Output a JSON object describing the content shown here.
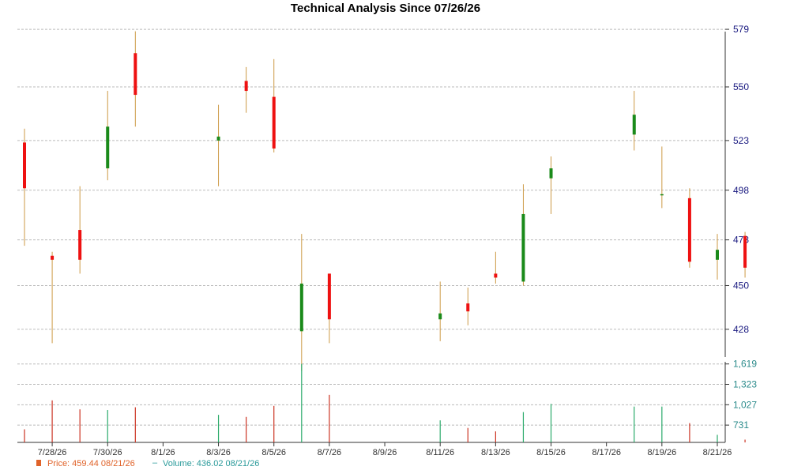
{
  "chart_data": {
    "type": "candlestick",
    "title": "Technical Analysis Since 07/26/26",
    "price_axis": {
      "ticks": [
        428,
        450,
        473,
        498,
        523,
        550,
        579
      ],
      "range": [
        414,
        585
      ]
    },
    "volume_axis": {
      "tick_labels": [
        "731",
        "1,027",
        "1,323",
        "1,619"
      ],
      "ticks": [
        731,
        1027,
        1323,
        1619
      ],
      "range": [
        480,
        1650
      ]
    },
    "x_tick_labels": [
      "7/28/26",
      "7/30/26",
      "8/1/26",
      "8/3/26",
      "8/5/26",
      "8/7/26",
      "8/9/26",
      "8/11/26",
      "8/13/26",
      "8/15/26",
      "8/17/26",
      "8/19/26",
      "8/21/26"
    ],
    "x_tick_dates": [
      "7/28",
      "7/30",
      "8/1",
      "8/3",
      "8/5",
      "8/7",
      "8/9",
      "8/11",
      "8/13",
      "8/15",
      "8/17",
      "8/19",
      "8/21"
    ],
    "first_date": "7/27",
    "last_date": "8/21",
    "candles": [
      {
        "date": "7/27",
        "open": 522,
        "high": 529,
        "low": 470,
        "close": 499,
        "volume": 670
      },
      {
        "date": "7/28",
        "open": 465,
        "high": 467,
        "low": 421,
        "close": 463,
        "volume": 1090
      },
      {
        "date": "7/29",
        "open": 478,
        "high": 500,
        "low": 456,
        "close": 463,
        "volume": 960
      },
      {
        "date": "7/30",
        "open": 509,
        "high": 548,
        "low": 503,
        "close": 530,
        "volume": 950
      },
      {
        "date": "7/31",
        "open": 567,
        "high": 578,
        "low": 530,
        "close": 546,
        "volume": 990
      },
      {
        "date": "8/3",
        "open": 523,
        "high": 541,
        "low": 500,
        "close": 525,
        "volume": 880
      },
      {
        "date": "8/4",
        "open": 553,
        "high": 560,
        "low": 537,
        "close": 548,
        "volume": 850
      },
      {
        "date": "8/5",
        "open": 545,
        "high": 564,
        "low": 517,
        "close": 519,
        "volume": 1010
      },
      {
        "date": "8/6",
        "open": 427,
        "high": 476,
        "low": 407,
        "close": 451,
        "volume": 1620
      },
      {
        "date": "8/7",
        "open": 456,
        "high": 456,
        "low": 421,
        "close": 433,
        "volume": 1170
      },
      {
        "date": "8/11",
        "open": 433,
        "high": 452,
        "low": 422,
        "close": 436,
        "volume": 800
      },
      {
        "date": "8/12",
        "open": 441,
        "high": 449,
        "low": 430,
        "close": 437,
        "volume": 690
      },
      {
        "date": "8/13",
        "open": 456,
        "high": 467,
        "low": 451,
        "close": 454,
        "volume": 640
      },
      {
        "date": "8/14",
        "open": 452,
        "high": 501,
        "low": 450,
        "close": 486,
        "volume": 920
      },
      {
        "date": "8/15",
        "open": 504,
        "high": 515,
        "low": 486,
        "close": 509,
        "volume": 1040
      },
      {
        "date": "8/18",
        "open": 526,
        "high": 548,
        "low": 518,
        "close": 536,
        "volume": 1000
      },
      {
        "date": "8/19",
        "open": 496,
        "high": 520,
        "low": 489,
        "close": 496,
        "volume": 1000
      },
      {
        "date": "8/20",
        "open": 494,
        "high": 499,
        "low": 459,
        "close": 462,
        "volume": 760
      },
      {
        "date": "8/21",
        "open": 463,
        "high": 476,
        "low": 453,
        "close": 468,
        "volume": 590
      },
      {
        "date": "8/22",
        "open": 475,
        "high": 477,
        "low": 454,
        "close": 459,
        "volume": 520
      }
    ],
    "colors": {
      "up": "#1a8a1a",
      "down": "#ee1111",
      "wick": "#cc9944",
      "vol_up": "#2aaa6a",
      "vol_down": "#cc3322",
      "grid": "#bbbbbb",
      "axis": "#333333"
    }
  },
  "legend": {
    "price_label": "Price: 459.44  08/21/26",
    "volume_label": "Volume: 436.02  08/21/26",
    "price_color": "#e0632a",
    "volume_color": "#2a9a9a"
  }
}
